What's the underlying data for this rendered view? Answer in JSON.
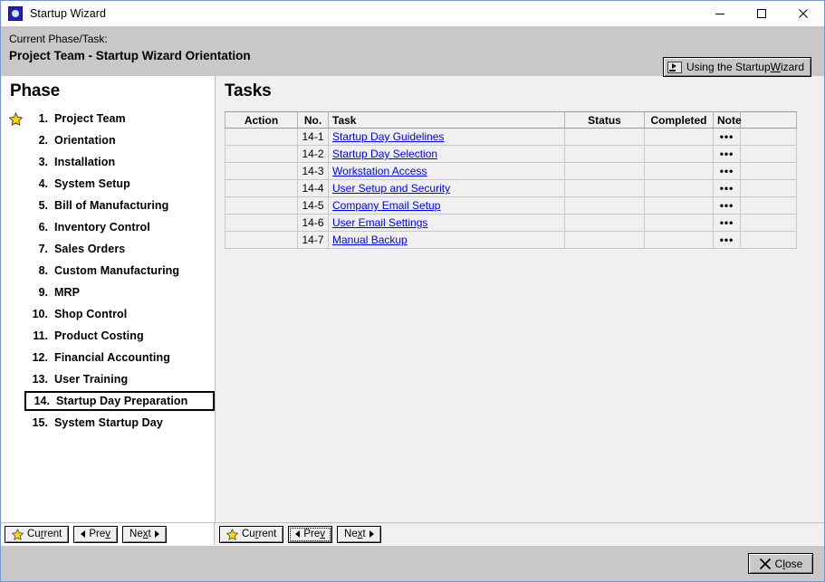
{
  "window": {
    "title": "Startup Wizard",
    "app_icon": "app-window-icon",
    "controls": {
      "minimize": "minimize-icon",
      "maximize": "maximize-icon",
      "close": "close-icon"
    },
    "border_color": "#7a96c8",
    "chrome_color": "#c8c8c8"
  },
  "phase_band": {
    "label": "Current Phase/Task:",
    "value": "Project Team - Startup Wizard Orientation",
    "help_button": {
      "label_pre": "Using the Startup ",
      "label_mnemonic": "W",
      "label_post": "izard",
      "icon": "video-play-icon"
    }
  },
  "phase_panel": {
    "title": "Phase",
    "star_icon": "star-icon",
    "items": [
      {
        "num": "1.",
        "label": "Project Team",
        "current": true,
        "selected": false
      },
      {
        "num": "2.",
        "label": "Orientation",
        "current": false,
        "selected": false
      },
      {
        "num": "3.",
        "label": "Installation",
        "current": false,
        "selected": false
      },
      {
        "num": "4.",
        "label": "System Setup",
        "current": false,
        "selected": false
      },
      {
        "num": "5.",
        "label": "Bill of Manufacturing",
        "current": false,
        "selected": false
      },
      {
        "num": "6.",
        "label": "Inventory Control",
        "current": false,
        "selected": false
      },
      {
        "num": "7.",
        "label": "Sales Orders",
        "current": false,
        "selected": false
      },
      {
        "num": "8.",
        "label": "Custom Manufacturing",
        "current": false,
        "selected": false
      },
      {
        "num": "9.",
        "label": "MRP",
        "current": false,
        "selected": false
      },
      {
        "num": "10.",
        "label": "Shop Control",
        "current": false,
        "selected": false
      },
      {
        "num": "11.",
        "label": "Product Costing",
        "current": false,
        "selected": false
      },
      {
        "num": "12.",
        "label": "Financial Accounting",
        "current": false,
        "selected": false
      },
      {
        "num": "13.",
        "label": "User Training",
        "current": false,
        "selected": false
      },
      {
        "num": "14.",
        "label": "Startup Day Preparation",
        "current": false,
        "selected": true
      },
      {
        "num": "15.",
        "label": "System Startup Day",
        "current": false,
        "selected": false
      }
    ],
    "nav": {
      "current": {
        "pre": "Cu",
        "mnemonic": "r",
        "post": "rent",
        "icon": "star-icon"
      },
      "prev": {
        "pre": "Pre",
        "mnemonic": "v",
        "post": "",
        "icon": "triangle-left-icon"
      },
      "next": {
        "pre": "Ne",
        "mnemonic": "x",
        "post": "t",
        "icon": "triangle-right-icon"
      }
    }
  },
  "tasks_panel": {
    "title": "Tasks",
    "columns": [
      "Action",
      "No.",
      "Task",
      "Status",
      "Completed",
      "Note",
      ""
    ],
    "note_glyph": "•••",
    "link_color": "#0000ff",
    "rows": [
      {
        "action": "",
        "no": "14-1",
        "task": "Startup Day Guidelines",
        "status": "",
        "completed": "",
        "note": "•••",
        "selected": true
      },
      {
        "action": "",
        "no": "14-2",
        "task": "Startup Day Selection",
        "status": "",
        "completed": "",
        "note": "•••",
        "selected": false
      },
      {
        "action": "",
        "no": "14-3",
        "task": "Workstation Access",
        "status": "",
        "completed": "",
        "note": "•••",
        "selected": false
      },
      {
        "action": "",
        "no": "14-4",
        "task": "User Setup and Security",
        "status": "",
        "completed": "",
        "note": "•••",
        "selected": false
      },
      {
        "action": "",
        "no": "14-5",
        "task": "Company Email Setup",
        "status": "",
        "completed": "",
        "note": "•••",
        "selected": false
      },
      {
        "action": "",
        "no": "14-6",
        "task": "User Email Settings",
        "status": "",
        "completed": "",
        "note": "•••",
        "selected": false
      },
      {
        "action": "",
        "no": "14-7",
        "task": "Manual Backup",
        "status": "",
        "completed": "",
        "note": "•••",
        "selected": false
      }
    ],
    "nav": {
      "current": {
        "pre": "Cu",
        "mnemonic": "r",
        "post": "rent",
        "icon": "star-icon"
      },
      "prev": {
        "pre": "Pre",
        "mnemonic": "v",
        "post": "",
        "icon": "triangle-left-icon",
        "focused": true
      },
      "next": {
        "pre": "Ne",
        "mnemonic": "x",
        "post": "t",
        "icon": "triangle-right-icon"
      }
    }
  },
  "footer": {
    "close": {
      "pre": "C",
      "mnemonic": "l",
      "post": "ose",
      "icon": "x-icon"
    }
  }
}
